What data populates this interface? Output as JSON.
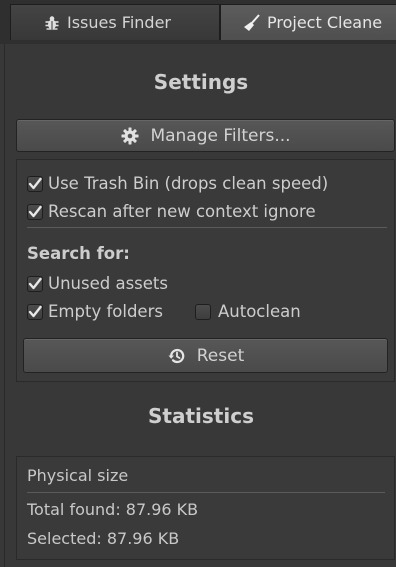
{
  "tabs": [
    {
      "label": "Issues Finder",
      "icon": "bug-icon",
      "active": false
    },
    {
      "label": "Project Cleane",
      "icon": "broom-icon",
      "active": true
    }
  ],
  "settings": {
    "title": "Settings",
    "manage_filters_label": "Manage Filters...",
    "options": {
      "use_trash_bin": {
        "label": "Use Trash Bin (drops clean speed)",
        "checked": true
      },
      "rescan": {
        "label": "Rescan after new context ignore",
        "checked": true
      }
    },
    "search_for": {
      "label": "Search for:",
      "unused_assets": {
        "label": "Unused assets",
        "checked": true
      },
      "empty_folders": {
        "label": "Empty folders",
        "checked": true
      },
      "autoclean": {
        "label": "Autoclean",
        "checked": false
      }
    },
    "reset_label": "Reset"
  },
  "statistics": {
    "title": "Statistics",
    "physical_size_label": "Physical size",
    "total_found": "Total found: 87.96 KB",
    "selected": "Selected: 87.96 KB"
  },
  "colors": {
    "background": "#383838",
    "text": "#cdcdcd",
    "checkmark": "#e8e8e8"
  }
}
